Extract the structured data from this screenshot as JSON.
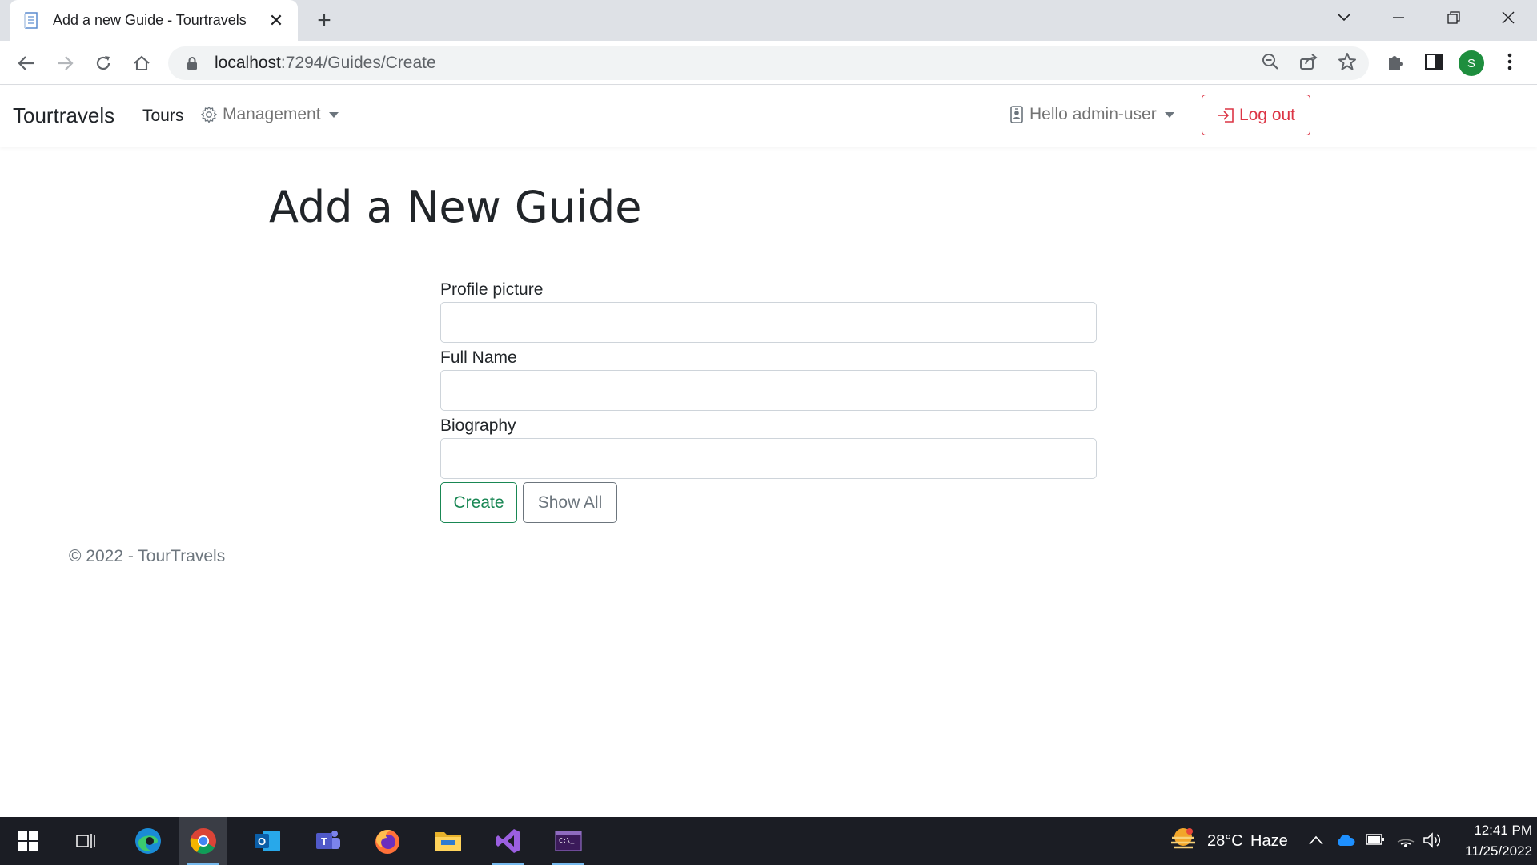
{
  "browser": {
    "tab_title": "Add a new Guide - Tourtravels",
    "url_host": "localhost",
    "url_path": ":7294/Guides/Create",
    "profile_initial": "S"
  },
  "nav": {
    "brand": "Tourtravels",
    "tours": "Tours",
    "management": "Management",
    "user_greeting": "Hello admin-user",
    "logout": "Log out"
  },
  "page": {
    "heading": "Add a New Guide"
  },
  "form": {
    "fields": [
      {
        "label": "Profile picture",
        "value": "",
        "placeholder": ""
      },
      {
        "label": "Full Name",
        "value": "",
        "placeholder": ""
      },
      {
        "label": "Biography",
        "value": "",
        "placeholder": ""
      }
    ],
    "create_label": "Create",
    "show_all_label": "Show All"
  },
  "footer": {
    "text": "© 2022 - TourTravels"
  },
  "taskbar": {
    "weather_temp": "28°C",
    "weather_desc": "Haze",
    "time": "12:41 PM",
    "date": "11/25/2022"
  },
  "colors": {
    "success": "#198754",
    "danger": "#dc3545",
    "secondary": "#6c757d"
  }
}
